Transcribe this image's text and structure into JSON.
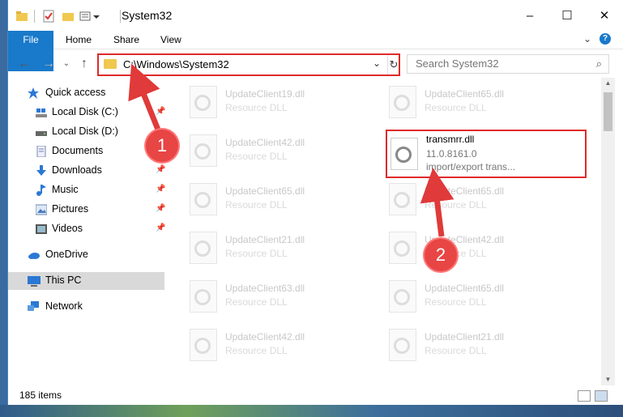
{
  "window": {
    "title": "System32",
    "controls": {
      "minimize": "–",
      "maximize": "☐",
      "close": "✕"
    }
  },
  "ribbon": {
    "tabs": [
      "File",
      "Home",
      "Share",
      "View"
    ]
  },
  "address": {
    "path": "C:\\Windows\\System32"
  },
  "search": {
    "placeholder": "Search System32"
  },
  "sidebar": {
    "items": [
      {
        "label": "Quick access",
        "icon": "star-icon",
        "pinned": false
      },
      {
        "label": "Local Disk (C:)",
        "icon": "drive-icon",
        "pinned": true
      },
      {
        "label": "Local Disk (D:)",
        "icon": "drive-icon",
        "pinned": false
      },
      {
        "label": "Documents",
        "icon": "documents-icon",
        "pinned": true
      },
      {
        "label": "Downloads",
        "icon": "downloads-icon",
        "pinned": true
      },
      {
        "label": "Music",
        "icon": "music-icon",
        "pinned": true
      },
      {
        "label": "Pictures",
        "icon": "pictures-icon",
        "pinned": true
      },
      {
        "label": "Videos",
        "icon": "videos-icon",
        "pinned": true
      },
      {
        "label": "OneDrive",
        "icon": "cloud-icon",
        "pinned": false
      },
      {
        "label": "This PC",
        "icon": "computer-icon",
        "pinned": false,
        "selected": true
      },
      {
        "label": "Network",
        "icon": "network-icon",
        "pinned": false
      }
    ]
  },
  "files": {
    "left": [
      {
        "name": "UpdateClient19.dll",
        "type": "Resource DLL"
      },
      {
        "name": "UpdateClient42.dll",
        "type": "Resource DLL"
      },
      {
        "name": "UpdateClient65.dll",
        "type": "Resource DLL"
      },
      {
        "name": "UpdateClient21.dll",
        "type": "Resource DLL"
      },
      {
        "name": "UpdateClient63.dll",
        "type": "Resource DLL"
      },
      {
        "name": "UpdateClient42.dll",
        "type": "Resource DLL"
      }
    ],
    "right": [
      {
        "name": "UpdateClient65.dll",
        "type": "Resource DLL"
      },
      {
        "name": "transmrr.dll",
        "version": "11.0.8161.0",
        "type": "import/export trans...",
        "highlighted": true
      },
      {
        "name": "UpdateClient65.dll",
        "type": "Resource DLL"
      },
      {
        "name": "UpdateClient42.dll",
        "type": "Resource DLL"
      },
      {
        "name": "UpdateClient65.dll",
        "type": "Resource DLL"
      },
      {
        "name": "UpdateClient21.dll",
        "type": "Resource DLL"
      }
    ]
  },
  "status": {
    "item_count": "185 items"
  },
  "annotations": {
    "step1": "1",
    "step2": "2",
    "color": "#e02a2a"
  }
}
